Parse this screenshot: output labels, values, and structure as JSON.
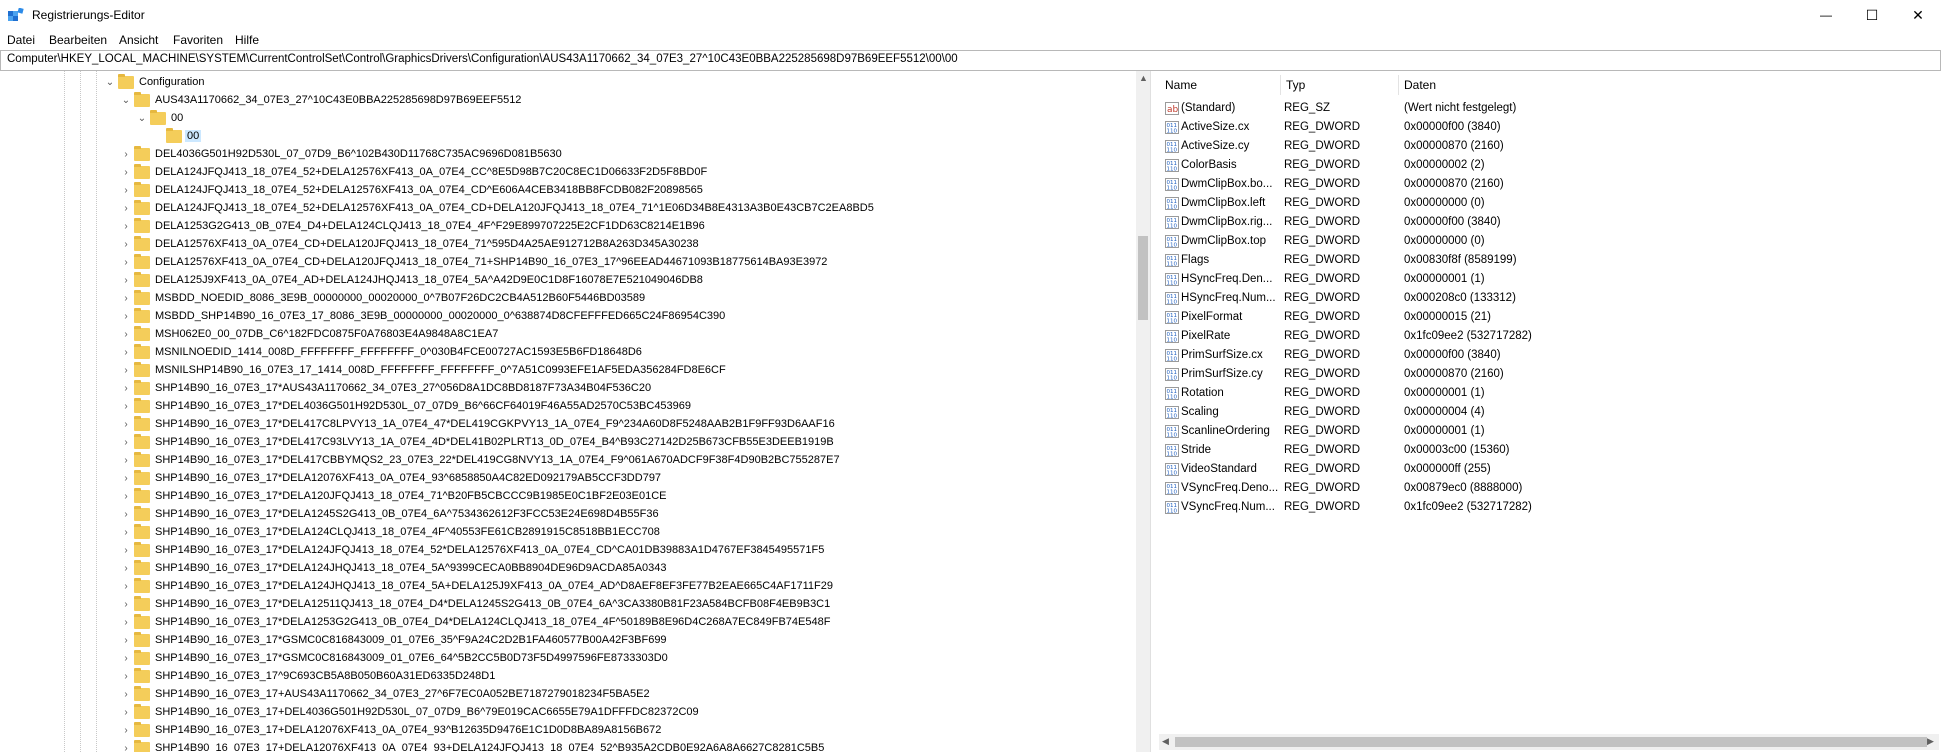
{
  "window": {
    "title": "Registrierungs-Editor",
    "minimize_glyph": "—",
    "maximize_glyph": "☐",
    "close_glyph": "✕"
  },
  "menu": [
    "Datei",
    "Bearbeiten",
    "Ansicht",
    "Favoriten",
    "Hilfe"
  ],
  "address": "Computer\\HKEY_LOCAL_MACHINE\\SYSTEM\\CurrentControlSet\\Control\\GraphicsDrivers\\Configuration\\AUS43A1170662_34_07E3_27^10C43E0BBA225285698D97B69EEF5512\\00\\00",
  "tree": {
    "config": "Configuration",
    "aus": "AUS43A1170662_34_07E3_27^10C43E0BBA225285698D97B69EEF5512",
    "sub00": "00",
    "sub00_selected": "00",
    "items": [
      "DEL4036G501H92D530L_07_07D9_B6^102B430D11768C735AC9696D081B5630",
      "DELA124JFQJ413_18_07E4_52+DELA12576XF413_0A_07E4_CC^8E5D98B7C20C8EC1D06633F2D5F8BD0F",
      "DELA124JFQJ413_18_07E4_52+DELA12576XF413_0A_07E4_CD^E606A4CEB3418BB8FCDB082F20898565",
      "DELA124JFQJ413_18_07E4_52+DELA12576XF413_0A_07E4_CD+DELA120JFQJ413_18_07E4_71^1E06D34B8E4313A3B0E43CB7C2EA8BD5",
      "DELA1253G2G413_0B_07E4_D4+DELA124CLQJ413_18_07E4_4F^F29E899707225E2CF1DD63C8214E1B96",
      "DELA12576XF413_0A_07E4_CD+DELA120JFQJ413_18_07E4_71^595D4A25AE912712B8A263D345A30238",
      "DELA12576XF413_0A_07E4_CD+DELA120JFQJ413_18_07E4_71+SHP14B90_16_07E3_17^96EEAD44671093B18775614BA93E3972",
      "DELA125J9XF413_0A_07E4_AD+DELA124JHQJ413_18_07E4_5A^A42D9E0C1D8F16078E7E521049046DB8",
      "MSBDD_NOEDID_8086_3E9B_00000000_00020000_0^7B07F26DC2CB4A512B60F5446BD03589",
      "MSBDD_SHP14B90_16_07E3_17_8086_3E9B_00000000_00020000_0^638874D8CFEFFFED665C24F86954C390",
      "MSH062E0_00_07DB_C6^182FDC0875F0A76803E4A9848A8C1EA7",
      "MSNILNOEDID_1414_008D_FFFFFFFF_FFFFFFFF_0^030B4FCE00727AC1593E5B6FD18648D6",
      "MSNILSHP14B90_16_07E3_17_1414_008D_FFFFFFFF_FFFFFFFF_0^7A51C0993EFE1AF5EDA356284FD8E6CF",
      "SHP14B90_16_07E3_17*AUS43A1170662_34_07E3_27^056D8A1DC8BD8187F73A34B04F536C20",
      "SHP14B90_16_07E3_17*DEL4036G501H92D530L_07_07D9_B6^66CF64019F46A55AD2570C53BC453969",
      "SHP14B90_16_07E3_17*DEL417C8LPVY13_1A_07E4_47*DEL419CGKPVY13_1A_07E4_F9^234A60D8F5248AAB2B1F9FF93D6AAF16",
      "SHP14B90_16_07E3_17*DEL417C93LVY13_1A_07E4_4D*DEL41B02PLRT13_0D_07E4_B4^B93C27142D25B673CFB55E3DEEB1919B",
      "SHP14B90_16_07E3_17*DEL417CBBYMQS2_23_07E3_22*DEL419CG8NVY13_1A_07E4_F9^061A670ADCF9F38F4D90B2BC755287E7",
      "SHP14B90_16_07E3_17*DELA12076XF413_0A_07E4_93^6858850A4C82ED092179AB5CCF3DD797",
      "SHP14B90_16_07E3_17*DELA120JFQJ413_18_07E4_71^B20FB5CBCCC9B1985E0C1BF2E03E01CE",
      "SHP14B90_16_07E3_17*DELA1245S2G413_0B_07E4_6A^7534362612F3FCC53E24E698D4B55F36",
      "SHP14B90_16_07E3_17*DELA124CLQJ413_18_07E4_4F^40553FE61CB2891915C8518BB1ECC708",
      "SHP14B90_16_07E3_17*DELA124JFQJ413_18_07E4_52*DELA12576XF413_0A_07E4_CD^CA01DB39883A1D4767EF3845495571F5",
      "SHP14B90_16_07E3_17*DELA124JHQJ413_18_07E4_5A^9399CECA0BB8904DE96D9ACDA85A0343",
      "SHP14B90_16_07E3_17*DELA124JHQJ413_18_07E4_5A+DELA125J9XF413_0A_07E4_AD^D8AEF8EF3FE77B2EAE665C4AF1711F29",
      "SHP14B90_16_07E3_17*DELA12511QJ413_18_07E4_D4*DELA1245S2G413_0B_07E4_6A^3CA3380B81F23A584BCFB08F4EB9B3C1",
      "SHP14B90_16_07E3_17*DELA1253G2G413_0B_07E4_D4*DELA124CLQJ413_18_07E4_4F^50189B8E96D4C268A7EC849FB74E548F",
      "SHP14B90_16_07E3_17*GSMC0C816843009_01_07E6_35^F9A24C2D2B1FA460577B00A42F3BF699",
      "SHP14B90_16_07E3_17*GSMC0C816843009_01_07E6_64^5B2CC5B0D73F5D4997596FE8733303D0",
      "SHP14B90_16_07E3_17^9C693CB5A8B050B60A31ED6335D248D1",
      "SHP14B90_16_07E3_17+AUS43A1170662_34_07E3_27^6F7EC0A052BE7187279018234F5BA5E2",
      "SHP14B90_16_07E3_17+DEL4036G501H92D530L_07_07D9_B6^79E019CAC6655E79A1DFFFDC82372C09",
      "SHP14B90_16_07E3_17+DELA12076XF413_0A_07E4_93^B12635D9476E1C1D0D8BA89A8156B672",
      "SHP14B90_16_07E3_17+DELA12076XF413_0A_07E4_93+DELA124JFQJ413_18_07E4_52^B935A2CDB0E92A6A8A6627C8281C5B5"
    ]
  },
  "values_header": {
    "name": "Name",
    "type": "Typ",
    "data": "Daten"
  },
  "values": [
    {
      "icon": "string-value-icon",
      "name": "(Standard)",
      "type": "REG_SZ",
      "data": "(Wert nicht festgelegt)"
    },
    {
      "icon": "binary-value-icon",
      "name": "ActiveSize.cx",
      "type": "REG_DWORD",
      "data": "0x00000f00 (3840)"
    },
    {
      "icon": "binary-value-icon",
      "name": "ActiveSize.cy",
      "type": "REG_DWORD",
      "data": "0x00000870 (2160)"
    },
    {
      "icon": "binary-value-icon",
      "name": "ColorBasis",
      "type": "REG_DWORD",
      "data": "0x00000002 (2)"
    },
    {
      "icon": "binary-value-icon",
      "name": "DwmClipBox.bo...",
      "type": "REG_DWORD",
      "data": "0x00000870 (2160)"
    },
    {
      "icon": "binary-value-icon",
      "name": "DwmClipBox.left",
      "type": "REG_DWORD",
      "data": "0x00000000 (0)"
    },
    {
      "icon": "binary-value-icon",
      "name": "DwmClipBox.rig...",
      "type": "REG_DWORD",
      "data": "0x00000f00 (3840)"
    },
    {
      "icon": "binary-value-icon",
      "name": "DwmClipBox.top",
      "type": "REG_DWORD",
      "data": "0x00000000 (0)"
    },
    {
      "icon": "binary-value-icon",
      "name": "Flags",
      "type": "REG_DWORD",
      "data": "0x00830f8f (8589199)"
    },
    {
      "icon": "binary-value-icon",
      "name": "HSyncFreq.Den...",
      "type": "REG_DWORD",
      "data": "0x00000001 (1)"
    },
    {
      "icon": "binary-value-icon",
      "name": "HSyncFreq.Num...",
      "type": "REG_DWORD",
      "data": "0x000208c0 (133312)"
    },
    {
      "icon": "binary-value-icon",
      "name": "PixelFormat",
      "type": "REG_DWORD",
      "data": "0x00000015 (21)"
    },
    {
      "icon": "binary-value-icon",
      "name": "PixelRate",
      "type": "REG_DWORD",
      "data": "0x1fc09ee2 (532717282)"
    },
    {
      "icon": "binary-value-icon",
      "name": "PrimSurfSize.cx",
      "type": "REG_DWORD",
      "data": "0x00000f00 (3840)"
    },
    {
      "icon": "binary-value-icon",
      "name": "PrimSurfSize.cy",
      "type": "REG_DWORD",
      "data": "0x00000870 (2160)"
    },
    {
      "icon": "binary-value-icon",
      "name": "Rotation",
      "type": "REG_DWORD",
      "data": "0x00000001 (1)"
    },
    {
      "icon": "binary-value-icon",
      "name": "Scaling",
      "type": "REG_DWORD",
      "data": "0x00000004 (4)"
    },
    {
      "icon": "binary-value-icon",
      "name": "ScanlineOrdering",
      "type": "REG_DWORD",
      "data": "0x00000001 (1)"
    },
    {
      "icon": "binary-value-icon",
      "name": "Stride",
      "type": "REG_DWORD",
      "data": "0x00003c00 (15360)"
    },
    {
      "icon": "binary-value-icon",
      "name": "VideoStandard",
      "type": "REG_DWORD",
      "data": "0x000000ff (255)"
    },
    {
      "icon": "binary-value-icon",
      "name": "VSyncFreq.Deno...",
      "type": "REG_DWORD",
      "data": "0x00879ec0 (8888000)"
    },
    {
      "icon": "binary-value-icon",
      "name": "VSyncFreq.Num...",
      "type": "REG_DWORD",
      "data": "0x1fc09ee2 (532717282)"
    }
  ],
  "colors": {
    "selection": "#cce8ff",
    "folder": "#f4cd5a",
    "accent": "#0078d7"
  }
}
